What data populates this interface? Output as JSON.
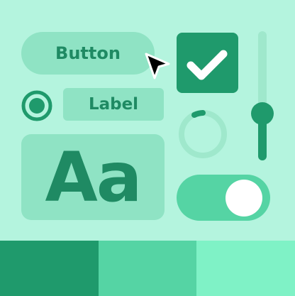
{
  "button": {
    "label": "Button"
  },
  "label_chip": {
    "text": "Label"
  },
  "typography": {
    "sample": "Aa"
  },
  "checkbox": {
    "checked": true
  },
  "radio": {
    "selected": true
  },
  "toggle": {
    "on": true
  },
  "slider": {
    "value_fraction": 0.35
  },
  "spinner": {
    "progress_fraction": 0.15
  },
  "icons": [
    "arrow-cursor-icon",
    "checkmark-icon",
    "radio-icon",
    "spinner-icon"
  ],
  "colors": {
    "background": "#b4f4de",
    "primary": "#1f9a6c",
    "muted": "#8fe3c4",
    "toggle": "#55d4a4",
    "swatches": [
      "#1f9a6c",
      "#55d4a4",
      "#7ff2c6"
    ]
  }
}
